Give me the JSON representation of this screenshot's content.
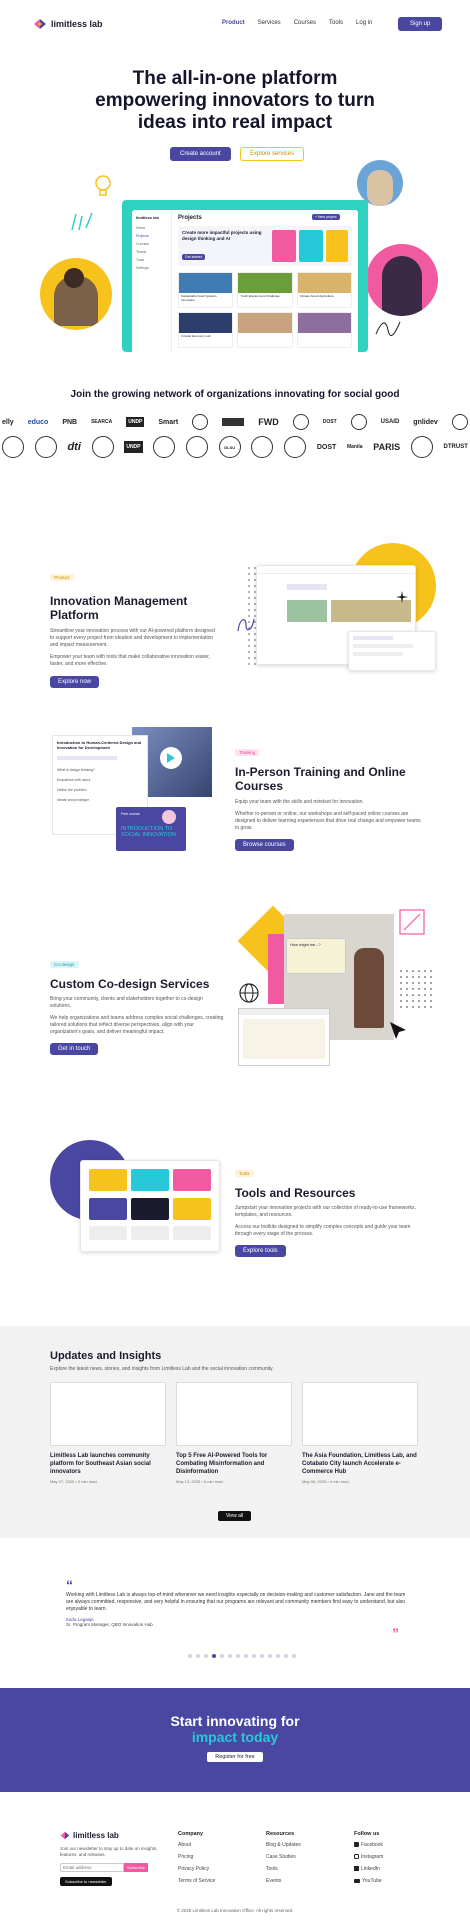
{
  "brand": {
    "name": "limitless lab",
    "primary": "#4a47a3",
    "accent_yellow": "#f8c21c",
    "accent_pink": "#f15aa0",
    "accent_teal": "#2fd1c1",
    "accent_cyan": "#27c9d8"
  },
  "nav": {
    "items": [
      "Product",
      "Services",
      "Courses",
      "Tools",
      "Log in"
    ],
    "signup": "Sign up"
  },
  "hero": {
    "title_line1": "The all-in-one platform",
    "title_line2": "empowering innovators to turn",
    "title_line3": "ideas into real impact",
    "primary_cta": "Create account",
    "secondary_cta": "Explore services",
    "mock": {
      "app_name": "limitless lab",
      "section": "Projects",
      "new_button": "+ New project",
      "banner_title": "Create more impactful projects using design thinking and AI",
      "banner_cta": "Get started",
      "sidebar": [
        "Home",
        "Projects",
        "Courses",
        "Teams",
        "Tools",
        "Settings"
      ],
      "cards": [
        "Sustainable Food Systems Innovation",
        "Youth Employment Challenge",
        "Climate Smart Agriculture",
        "Circular Economy Lab"
      ]
    }
  },
  "partners": {
    "title": "Join the growing network of organizations innovating for social good",
    "row1": [
      "elly",
      "educo",
      "PNB",
      "SEARCA",
      "UNDP",
      "Smart",
      "",
      "",
      "FWD",
      "",
      "DOST",
      "",
      "USAID",
      "gnlidev",
      ""
    ],
    "row2": [
      "",
      "",
      "dti",
      "",
      "UNDP",
      "",
      "",
      "DLSU",
      "",
      "",
      "DOST",
      "Manila",
      "PARIS",
      "",
      "DTRUST"
    ]
  },
  "features": [
    {
      "tag": "Product",
      "title": "Innovation Management Platform",
      "desc1": "Streamline your innovation process with our AI-powered platform designed to support every project from ideation and development to implementation and impact measurement.",
      "desc2": "Empower your team with tools that make collaborative innovation easier, faster, and more effective.",
      "cta": "Explore now"
    },
    {
      "tag": "Training",
      "title_line1": "In-Person Training and Online",
      "title_line2": "Courses",
      "desc1": "Equip your team with the skills and mindset for innovation.",
      "desc2": "Whether in-person or online, our workshops and self-paced online courses are designed to deliver learning experiences that drive real change and empower teams to grow.",
      "cta": "Browse courses",
      "course_title_line1": "INTRODUCTION TO",
      "course_title_line2": "SOCIAL INNOVATION",
      "course_tag": "Free course",
      "panel_title": "Introduction to Human-Centered Design and Innovation for Development",
      "panel_items": [
        "What is design thinking?",
        "Empathize with users",
        "Define the problem",
        "Ideate and prototype"
      ]
    },
    {
      "tag": "Co-design",
      "title": "Custom Co-design Services",
      "desc1": "Bring your community, clients and stakeholders together to co-design solutions.",
      "desc2": "We help organizations and teams address complex social challenges, creating tailored solutions that reflect diverse perspectives, align with your organization's goals, and deliver meaningful impact.",
      "cta": "Get in touch",
      "board_title": "How might we...?"
    },
    {
      "tag": "Tools",
      "title": "Tools and Resources",
      "desc1": "Jumpstart your innovation projects with our collection of ready-to-use frameworks, templates, and resources.",
      "desc2": "Access our toolkits designed to simplify complex concepts and guide your team through every stage of the process.",
      "cta": "Explore tools"
    }
  ],
  "updates": {
    "title": "Updates and Insights",
    "subtitle": "Explore the latest news, stories, and insights from Limitless Lab and the social innovation community.",
    "posts": [
      {
        "title": "Limitless Lab launches community platform for Southeast Asian social innovators",
        "meta": "May 27, 2025  •  3 min read"
      },
      {
        "title": "Top 5 Free AI-Powered Tools for Combating Misinformation and Disinformation",
        "meta": "May 13, 2025  •  5 min read"
      },
      {
        "title": "The Asia Foundation, Limitless Lab, and Cotabato City launch Accelerate e-Commerce Hub",
        "meta": "May 06, 2025  •  4 min read"
      }
    ],
    "cta": "View all"
  },
  "testimonial": {
    "quote": "Working with Limitless Lab is always top-of-mind whenever we need insights especially on decision-making and customer satisfaction. Jane and the team are always committed, responsive, and very helpful in ensuring that our programs are relevant and community members find easy to understand, but also enjoyable to learn.",
    "name": "Karla Legaspi",
    "role": "Sr. Program Manager, QBO Innovation Hub",
    "dots": 14,
    "active_dot": 3
  },
  "cta_band": {
    "line1": "Start innovating for",
    "line2": "impact today",
    "button": "Register for free"
  },
  "footer": {
    "brand": "limitless lab",
    "blurb": "Join our newsletter to stay up to date on insights, features, and releases.",
    "email_placeholder": "Email address",
    "subscribe": "Subscribe",
    "sub_button": "Subscribe to newsletter",
    "columns": [
      {
        "title": "Company",
        "links": [
          "About",
          "Pricing",
          "Privacy Policy",
          "Terms of Service"
        ]
      },
      {
        "title": "Resources",
        "links": [
          "Blog & Updates",
          "Case Studies",
          "Tools",
          "Events"
        ]
      },
      {
        "title": "Follow us",
        "links": [
          "Facebook",
          "Instagram",
          "LinkedIn",
          "YouTube"
        ]
      }
    ],
    "copyright": "© 2025 Limitless Lab Innovation Office. All rights reserved."
  }
}
